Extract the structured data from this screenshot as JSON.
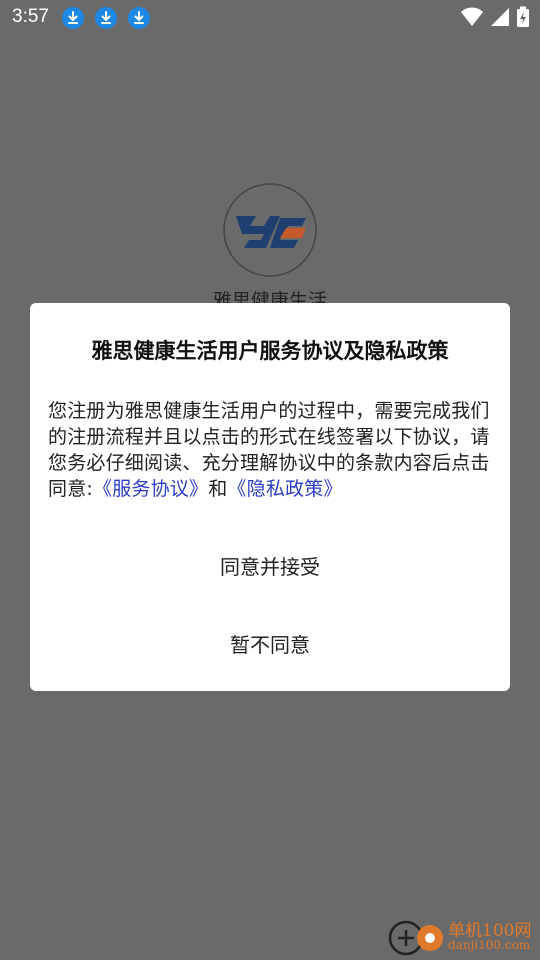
{
  "status_bar": {
    "time": "3:57",
    "download_icons": [
      "download-icon",
      "download-icon",
      "download-icon"
    ],
    "system_icons": [
      "wifi-icon",
      "signal-icon",
      "battery-charging-icon"
    ]
  },
  "background": {
    "app_name": "雅思健康生活"
  },
  "dialog": {
    "title": "雅思健康生活用户服务协议及隐私政策",
    "body_text": "您注册为雅思健康生活用户的过程中，需要完成我们的注册流程并且以点击的形式在线签署以下协议，请您务必仔细阅读、充分理解协议中的条款内容后点击同意:",
    "service_agreement_link": "《服务协议》",
    "conjunction": "和",
    "privacy_policy_link": "《隐私政策》",
    "agree_button": "同意并接受",
    "disagree_button": "暂不同意"
  },
  "watermark": {
    "brand": "单机100网",
    "domain": "danji100.com"
  },
  "colors": {
    "overlay": "#6a6a6a",
    "link": "#2a3ec6",
    "download_badge": "#1e88e5",
    "watermark": "#e0792a"
  }
}
